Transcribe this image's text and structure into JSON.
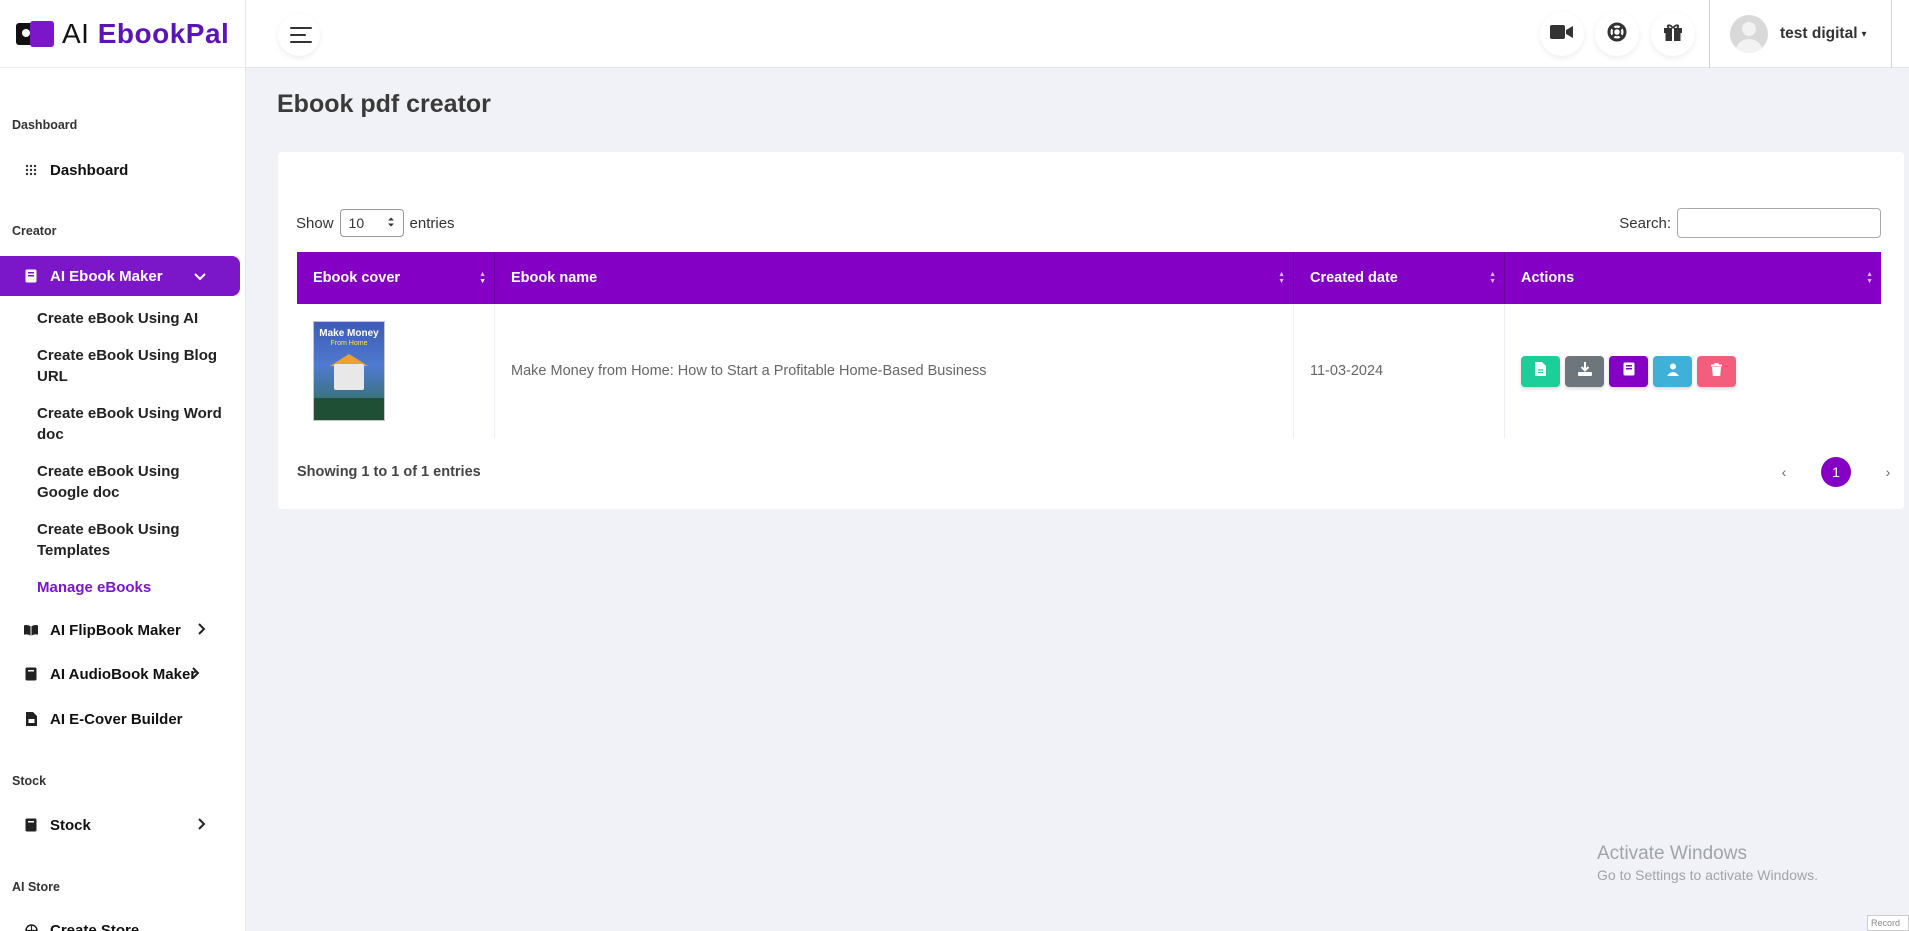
{
  "app": {
    "logo_ai": "AI",
    "logo_brand": "EbookPal"
  },
  "sidebar": {
    "sections": {
      "dashboard": "Dashboard",
      "creator": "Creator",
      "stock": "Stock",
      "ai_store": "AI Store"
    },
    "items": {
      "dashboard": "Dashboard",
      "ai_ebook_maker": "AI Ebook Maker",
      "ai_flipbook_maker": "AI FlipBook Maker",
      "ai_audiobook_maker": "AI AudioBook Maker",
      "ai_ecover_builder": "AI E-Cover Builder",
      "stock": "Stock",
      "create_store": "Create Store"
    },
    "sub_items": [
      "Create eBook Using AI",
      "Create eBook Using Blog URL",
      "Create eBook Using Word doc",
      "Create eBook Using Google doc",
      "Create eBook Using Templates",
      "Manage eBooks"
    ]
  },
  "header": {
    "user_name": "test digital",
    "user_caret": "▾"
  },
  "main": {
    "page_title": "Ebook pdf creator",
    "show_label": "Show",
    "entries_label": "entries",
    "page_length": "10",
    "search_label": "Search:",
    "table": {
      "columns": [
        "Ebook cover",
        "Ebook name",
        "Created date",
        "Actions"
      ],
      "rows": [
        {
          "cover_title": "Make Money",
          "cover_subtitle": "From Home",
          "name": "Make Money from Home: How to Start a Profitable Home-Based Business",
          "created": "11-03-2024"
        }
      ]
    },
    "info": "Showing 1 to 1 of 1 entries",
    "pagination": {
      "prev": "‹",
      "current": "1",
      "next": "›"
    }
  },
  "watermark": {
    "line1": "Activate Windows",
    "line2": "Go to Settings to activate Windows.",
    "badge": "Record"
  },
  "colors": {
    "accent": "#8300c4",
    "brand": "#5b14b8",
    "action_green": "#1ccf98",
    "action_gray": "#6d757d",
    "action_teal": "#3fb0d8",
    "action_red": "#f45e7d"
  },
  "icons": {
    "header": [
      "video-camera-icon",
      "lifebuoy-icon",
      "gift-icon"
    ],
    "row_actions": [
      "pdf-file-icon",
      "download-icon",
      "book-icon",
      "publish-icon",
      "trash-icon"
    ]
  }
}
